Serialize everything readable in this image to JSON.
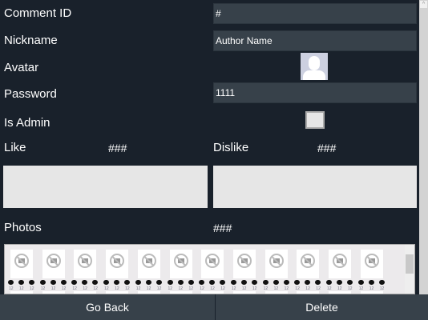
{
  "labels": {
    "comment_id": "Comment ID",
    "nickname": "Nickname",
    "avatar": "Avatar",
    "password": "Password",
    "is_admin": "Is Admin",
    "like": "Like",
    "dislike": "Dislike",
    "photos": "Photos"
  },
  "fields": {
    "comment_id": "#",
    "nickname": "Author Name",
    "password": "1111"
  },
  "values": {
    "like": "###",
    "dislike": "###",
    "photos": "###"
  },
  "is_admin_checked": false,
  "photo_count_label": "12",
  "buttons": {
    "back": "Go Back",
    "delete": "Delete"
  }
}
